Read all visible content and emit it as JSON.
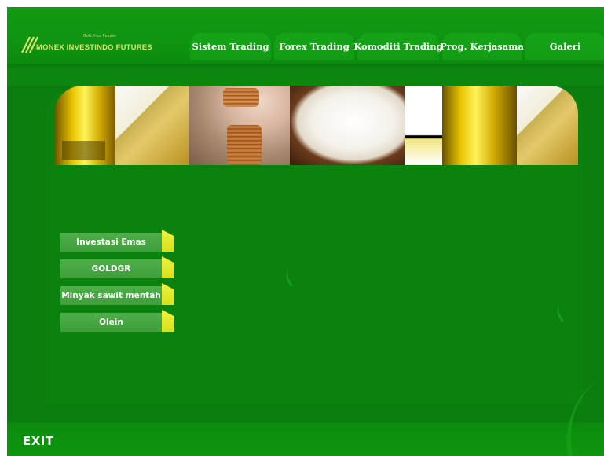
{
  "header": {
    "logo_tagline": "Gold Price Futures",
    "logo_name": "MONEX INVESTINDO FUTURES",
    "logo_icon": "triple-slash-icon"
  },
  "nav": {
    "tabs": [
      {
        "label": "Sistem Trading"
      },
      {
        "label": "Forex Trading"
      },
      {
        "label": "Komoditi Trading"
      },
      {
        "label": "Prog. Kerjasama"
      },
      {
        "label": "Galeri"
      }
    ]
  },
  "menu": {
    "items": [
      {
        "label": "Investasi Emas"
      },
      {
        "label": "GOLDGR"
      },
      {
        "label": "Minyak sawit mentah"
      },
      {
        "label": "Olein"
      }
    ]
  },
  "footer": {
    "exit_label": "EXIT"
  },
  "colors": {
    "background": "#0a7d0e",
    "header": "#119a13",
    "menu_face": "#4fae4a",
    "menu_tab": "#e2ea2c",
    "logo_text": "#d8e36a"
  }
}
